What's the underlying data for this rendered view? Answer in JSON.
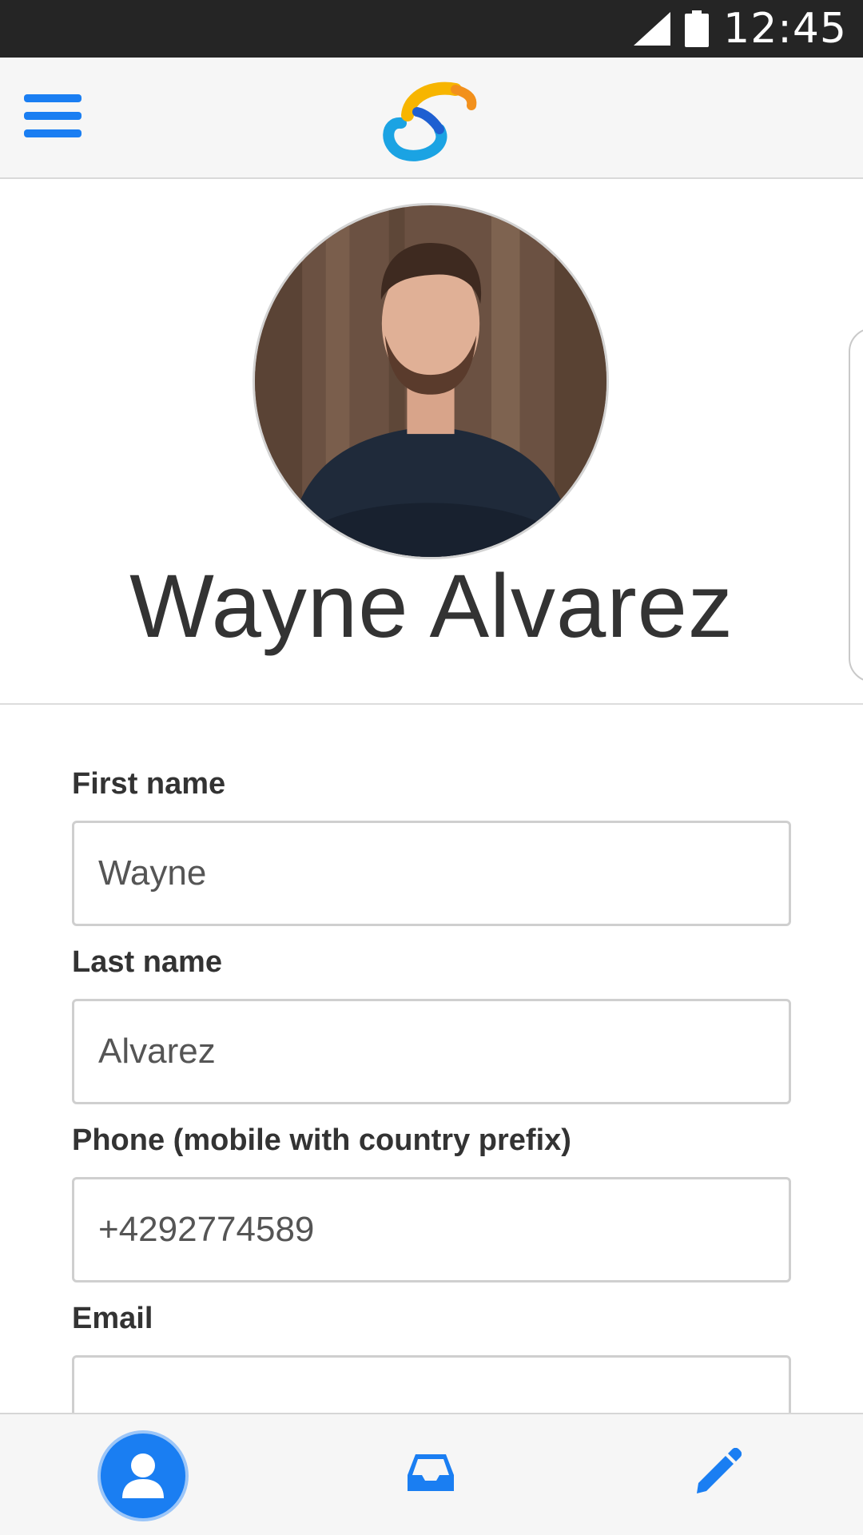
{
  "status_bar": {
    "time": "12:45"
  },
  "header": {
    "menu_icon": "hamburger-menu-icon",
    "logo": "app-logo"
  },
  "profile": {
    "name": "Wayne Alvarez",
    "avatar": "profile-photo"
  },
  "form": {
    "first_name": {
      "label": "First name",
      "value": "Wayne"
    },
    "last_name": {
      "label": "Last name",
      "value": "Alvarez"
    },
    "phone": {
      "label": "Phone (mobile with country prefix)",
      "value": "+4292774589"
    },
    "email": {
      "label": "Email",
      "value": ""
    }
  },
  "bottom_nav": {
    "items": [
      {
        "icon": "user-icon",
        "active": true
      },
      {
        "icon": "inbox-icon",
        "active": false
      },
      {
        "icon": "pencil-icon",
        "active": false
      }
    ]
  },
  "colors": {
    "accent": "#1a7ef2",
    "status_bar": "#252525",
    "header_bg": "#f6f6f6"
  }
}
